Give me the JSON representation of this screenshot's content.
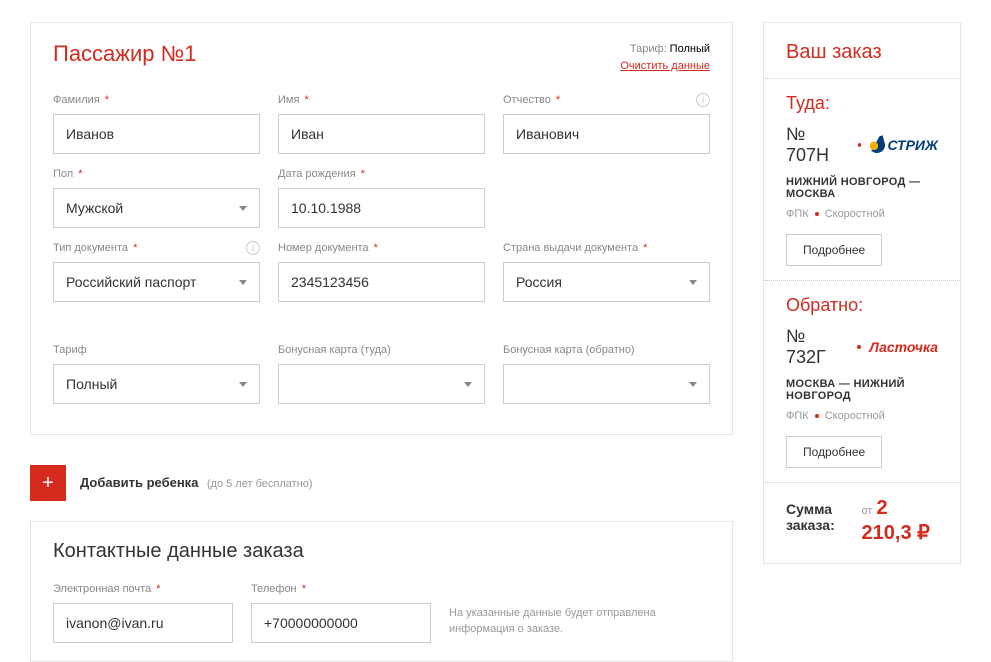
{
  "passenger": {
    "title": "Пассажир №1",
    "tariff_label": "Тариф:",
    "tariff_value": "Полный",
    "clear": "Очистить данные",
    "fields": {
      "lastname": {
        "label": "Фамилия",
        "value": "Иванов"
      },
      "firstname": {
        "label": "Имя",
        "value": "Иван"
      },
      "patronymic": {
        "label": "Отчество",
        "value": "Иванович"
      },
      "gender": {
        "label": "Пол",
        "value": "Мужской"
      },
      "dob": {
        "label": "Дата рождения",
        "value": "10.10.1988"
      },
      "doctype": {
        "label": "Тип документа",
        "value": "Российский паспорт"
      },
      "docnum": {
        "label": "Номер документа",
        "value": "2345123456"
      },
      "country": {
        "label": "Страна выдачи документа",
        "value": "Россия"
      },
      "tariff": {
        "label": "Тариф",
        "value": "Полный"
      },
      "bonus_to": {
        "label": "Бонусная карта (туда)",
        "value": ""
      },
      "bonus_back": {
        "label": "Бонусная карта (обратно)",
        "value": ""
      }
    }
  },
  "add_child": {
    "label": "Добавить ребенка",
    "hint": "(до 5 лет бесплатно)"
  },
  "contact": {
    "title": "Контактные данные заказа",
    "email": {
      "label": "Электронная почта",
      "value": "ivanon@ivan.ru"
    },
    "phone": {
      "label": "Телефон",
      "value": "+70000000000"
    },
    "hint": "На указанные данные будет отправлена информация о заказе."
  },
  "order": {
    "title": "Ваш заказ",
    "to": {
      "dir": "Туда:",
      "train": "№ 707Н",
      "brand": "СТРИЖ",
      "route": "НИЖНИЙ НОВГОРОД — МОСКВА",
      "carrier": "ФПК",
      "type": "Скоростной",
      "more": "Подробнее"
    },
    "back": {
      "dir": "Обратно:",
      "train": "№ 732Г",
      "brand": "Ласточка",
      "route": "МОСКВА — НИЖНИЙ НОВГОРОД",
      "carrier": "ФПК",
      "type": "Скоростной",
      "more": "Подробнее"
    },
    "total_label": "Сумма заказа:",
    "total_from": "от",
    "total_price": "2 210,3",
    "currency": "₽"
  }
}
